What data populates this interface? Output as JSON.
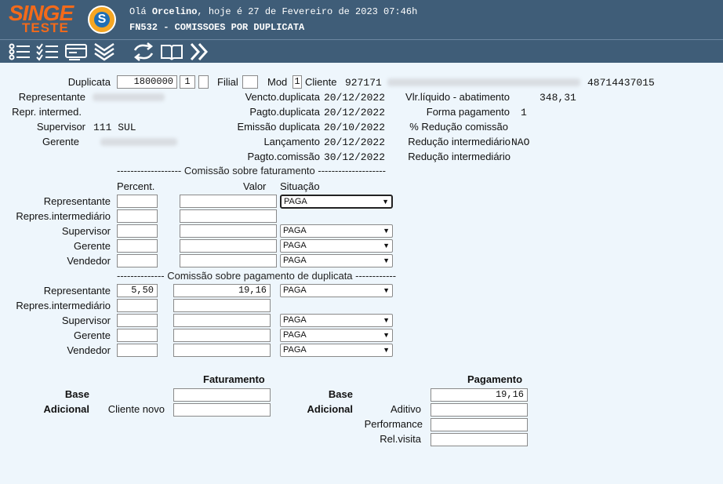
{
  "header": {
    "logo_main": "SINGE",
    "logo_sub": "TESTE",
    "logo_mark": "S",
    "greeting_prefix": "Olá",
    "user_name": "Orcelino",
    "greeting_suffix": ", hoje é 27 de Fevereiro de 2023 07:46h",
    "screen_title": "FN532 - COMISSOES POR DUPLICATA"
  },
  "toolbar": {
    "icons": [
      "list-icon",
      "checklist-icon",
      "card-icon",
      "chevrons-down-icon",
      "refresh-icon",
      "book-icon",
      "chevrons-right-icon"
    ]
  },
  "form": {
    "duplicata_label": "Duplicata",
    "duplicata_value": "1800000",
    "duplicata_seq": "1",
    "duplicata_extra": "",
    "filial_label": "Filial",
    "filial_value": "",
    "mod_label": "Mod",
    "mod_value": "1",
    "cliente_label": "Cliente",
    "cliente_code": "927171",
    "cliente_doc": "48714437015",
    "representante_label": "Representante",
    "repr_intermed_label": "Repr. intermed.",
    "supervisor_label": "Supervisor",
    "supervisor_value": "111 SUL",
    "gerente_label": "Gerente",
    "vencto_label": "Vencto.duplicata",
    "vencto_value": "20/12/2022",
    "pagto_label": "Pagto.duplicata",
    "pagto_value": "20/12/2022",
    "emissao_label": "Emissão duplicata",
    "emissao_value": "20/10/2022",
    "lancamento_label": "Lançamento",
    "lancamento_value": "20/12/2022",
    "pagto_comissao_label": "Pagto.comissão",
    "pagto_comissao_value": "30/12/2022",
    "vlr_liquido_label": "Vlr.líquido - abatimento",
    "vlr_liquido_value": "348,31",
    "forma_pagamento_label": "Forma pagamento",
    "forma_pagamento_value": "1",
    "reducao_comissao_label": "% Redução comissão",
    "reducao_intermediario_label": "Redução intermediário",
    "reducao_intermediario_value": "NAO",
    "reducao_intermediario2_label": "Redução intermediário"
  },
  "faturamento_section": {
    "title": "------------------- Comissão sobre faturamento --------------------",
    "col_percent": "Percent.",
    "col_valor": "Valor",
    "col_situacao": "Situação",
    "rows": [
      {
        "label": "Representante",
        "percent": "",
        "valor": "",
        "situacao": "PAGA"
      },
      {
        "label": "Repres.intermediário",
        "percent": "",
        "valor": "",
        "situacao": ""
      },
      {
        "label": "Supervisor",
        "percent": "",
        "valor": "",
        "situacao": "PAGA"
      },
      {
        "label": "Gerente",
        "percent": "",
        "valor": "",
        "situacao": "PAGA"
      },
      {
        "label": "Vendedor",
        "percent": "",
        "valor": "",
        "situacao": "PAGA"
      }
    ]
  },
  "pagamento_section": {
    "title": "-------------- Comissão sobre pagamento de duplicata ------------",
    "rows": [
      {
        "label": "Representante",
        "percent": "5,50",
        "valor": "19,16",
        "situacao": "PAGA"
      },
      {
        "label": "Repres.intermediário",
        "percent": "",
        "valor": "",
        "situacao": ""
      },
      {
        "label": "Supervisor",
        "percent": "",
        "valor": "",
        "situacao": "PAGA"
      },
      {
        "label": "Gerente",
        "percent": "",
        "valor": "",
        "situacao": "PAGA"
      },
      {
        "label": "Vendedor",
        "percent": "",
        "valor": "",
        "situacao": "PAGA"
      }
    ]
  },
  "totals": {
    "faturamento_title": "Faturamento",
    "pagamento_title": "Pagamento",
    "base_label": "Base",
    "adicional_label": "Adicional",
    "cliente_novo_label": "Cliente novo",
    "fat_base_value": "",
    "fat_cliente_novo_value": "",
    "pag_base_value": "19,16",
    "aditivo_label": "Aditivo",
    "aditivo_value": "",
    "performance_label": "Performance",
    "performance_value": "",
    "rel_visita_label": "Rel.visita",
    "rel_visita_value": ""
  }
}
